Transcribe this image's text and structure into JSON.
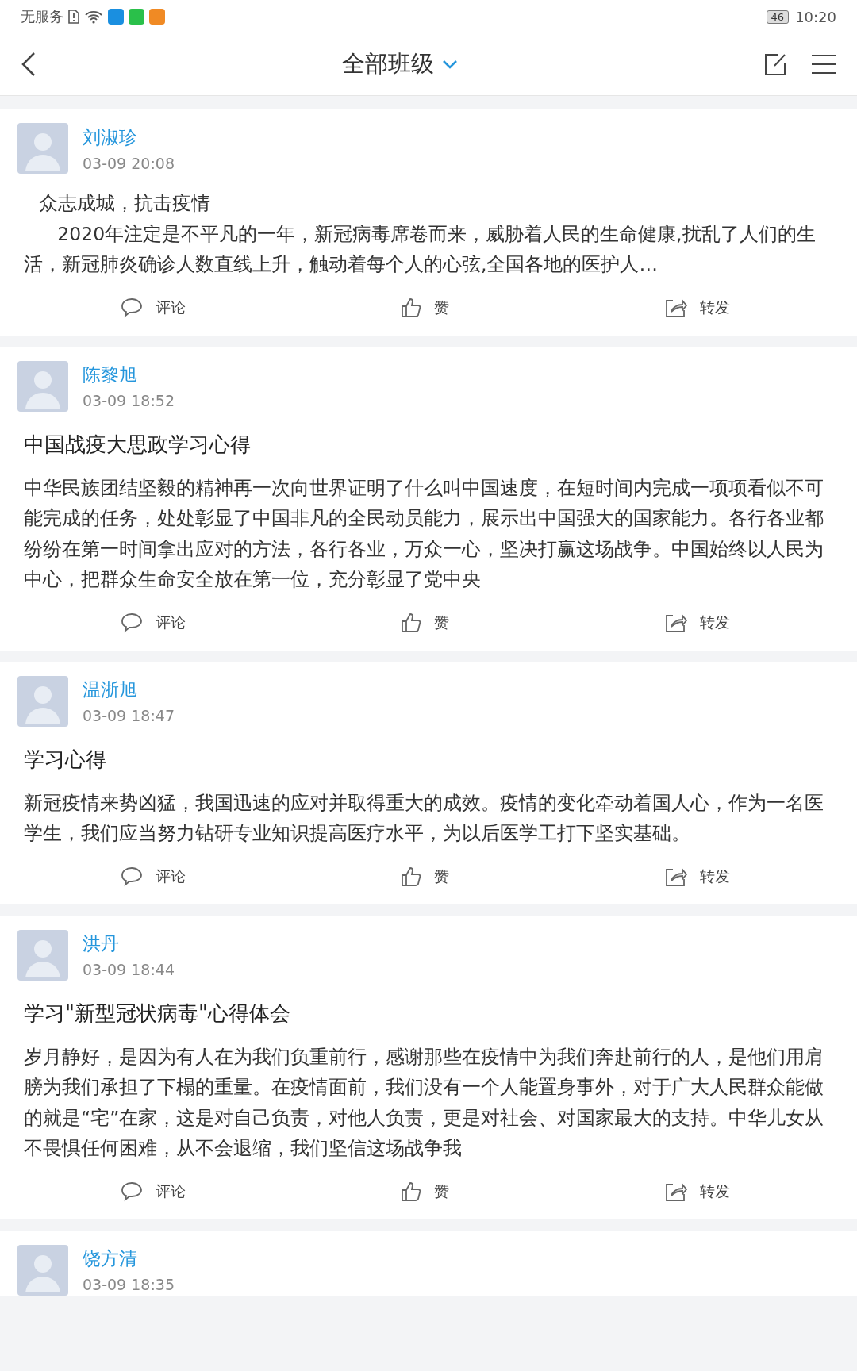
{
  "status_bar": {
    "carrier": "无服务",
    "battery": "46",
    "time": "10:20"
  },
  "header": {
    "title": "全部班级"
  },
  "posts": [
    {
      "author": "刘淑珍",
      "time": "03-09 20:08",
      "paragraphs": [
        "众志成城，抗击疫情",
        "2020年注定是不平凡的一年，新冠病毒席卷而来，威胁着人民的生命健康,扰乱了人们的生活，新冠肺炎确诊人数直线上升，触动着每个人的心弦,全国各地的医护人…"
      ],
      "actions": [
        "评论",
        "赞",
        "转发"
      ]
    },
    {
      "author": "陈黎旭",
      "time": "03-09 18:52",
      "title": "中国战疫大思政学习心得",
      "paragraphs": [
        "中华民族团结坚毅的精神再一次向世界证明了什么叫中国速度，在短时间内完成一项项看似不可能完成的任务，处处彰显了中国非凡的全民动员能力，展示出中国强大的国家能力。各行各业都纷纷在第一时间拿出应对的方法，各行各业，万众一心，坚决打赢这场战争。中国始终以人民为中心，把群众生命安全放在第一位，充分彰显了党中央"
      ],
      "actions": [
        "评论",
        "赞",
        "转发"
      ]
    },
    {
      "author": "温浙旭",
      "time": "03-09 18:47",
      "title": "学习心得",
      "paragraphs": [
        "新冠疫情来势凶猛，我国迅速的应对并取得重大的成效。疫情的变化牵动着国人心，作为一名医学生，我们应当努力钻研专业知识提高医疗水平，为以后医学工打下坚实基础。"
      ],
      "actions": [
        "评论",
        "赞",
        "转发"
      ]
    },
    {
      "author": "洪丹",
      "time": "03-09 18:44",
      "title": "学习\"新型冠状病毒\"心得体会",
      "paragraphs": [
        "岁月静好，是因为有人在为我们负重前行，感谢那些在疫情中为我们奔赴前行的人，是他们用肩膀为我们承担了下榻的重量。在疫情面前，我们没有一个人能置身事外，对于广大人民群众能做的就是“宅”在家，这是对自己负责，对他人负责，更是对社会、对国家最大的支持。中华儿女从不畏惧任何困难，从不会退缩，我们坚信这场战争我"
      ],
      "actions": [
        "评论",
        "赞",
        "转发"
      ]
    },
    {
      "author": "饶方清",
      "time": "03-09 18:35"
    }
  ]
}
